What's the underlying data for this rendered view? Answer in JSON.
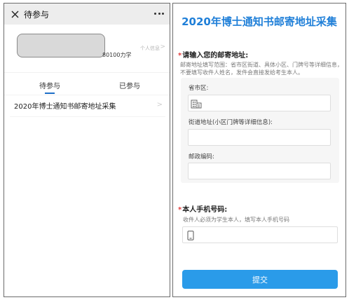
{
  "left_panel": {
    "topbar": {
      "title": "待参与"
    },
    "profile": {
      "school_text": "80100力学",
      "info_link": "个人信息"
    },
    "tabs": [
      {
        "label": "待参与",
        "active": true
      },
      {
        "label": "已参与",
        "active": false
      }
    ],
    "list": [
      {
        "title": "2020年博士通知书邮寄地址采集"
      }
    ],
    "icons": {
      "close": "close-icon",
      "more": "more-icon",
      "chevron": "chevron-right-icon"
    }
  },
  "right_panel": {
    "title": "2020年博士通知书邮寄地址采集",
    "question1": {
      "required_mark": "*",
      "label": "请输入您的邮寄地址:",
      "description": "邮寄地址填写范围：省市区街道、具体小区、门牌号等详细信息，不要填写收件人姓名，发件会直接发给考生本人。",
      "fields": [
        {
          "label": "省市区:",
          "value": ""
        },
        {
          "label": "街道地址(小区门牌等详细信息):",
          "value": ""
        },
        {
          "label": "邮政编码:",
          "value": ""
        }
      ]
    },
    "question2": {
      "required_mark": "*",
      "label": "本人手机号码:",
      "description": "收件人必须为学生本人，填写本人手机号码",
      "value": ""
    },
    "submit_label": "提交",
    "colors": {
      "accent": "#1f7fd8",
      "button": "#2a9be9",
      "required": "#e23b3b"
    }
  }
}
